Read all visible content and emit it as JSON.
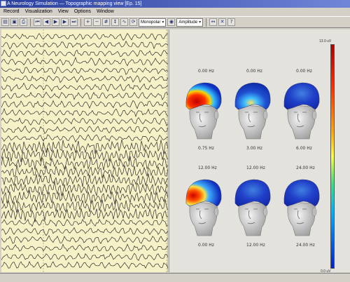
{
  "window": {
    "title": "A Neurology Simulation — Topographic mapping view [Ep. 15]"
  },
  "menu": {
    "items": [
      "Record",
      "Visualization",
      "View",
      "Options",
      "Window"
    ]
  },
  "toolbar": {
    "montage_combo": "Monopolar",
    "speed_combo": "Amplitude"
  },
  "maps": {
    "labels": {
      "r1": [
        "0.00 Hz",
        "0.00 Hz",
        "0.00 Hz"
      ],
      "r2": [
        "0.75 Hz",
        "3.00 Hz",
        "6.00 Hz"
      ],
      "r3": [
        "12.00 Hz",
        "12.00 Hz",
        "24.00 Hz"
      ],
      "r4": [
        "0.00 Hz",
        "12.00 Hz",
        "24.00 Hz"
      ]
    },
    "colorbar": {
      "max_label": "13.0 uV",
      "min_label": "0.0 uV"
    },
    "heads": [
      {
        "hot": "front-red"
      },
      {
        "hot": "mild"
      },
      {
        "hot": "cool"
      },
      {
        "hot": "left-red"
      },
      {
        "hot": "cool"
      },
      {
        "hot": "cool"
      }
    ]
  },
  "eeg": {
    "channel_count": 28,
    "dashed_markers": [
      60,
      240
    ]
  }
}
